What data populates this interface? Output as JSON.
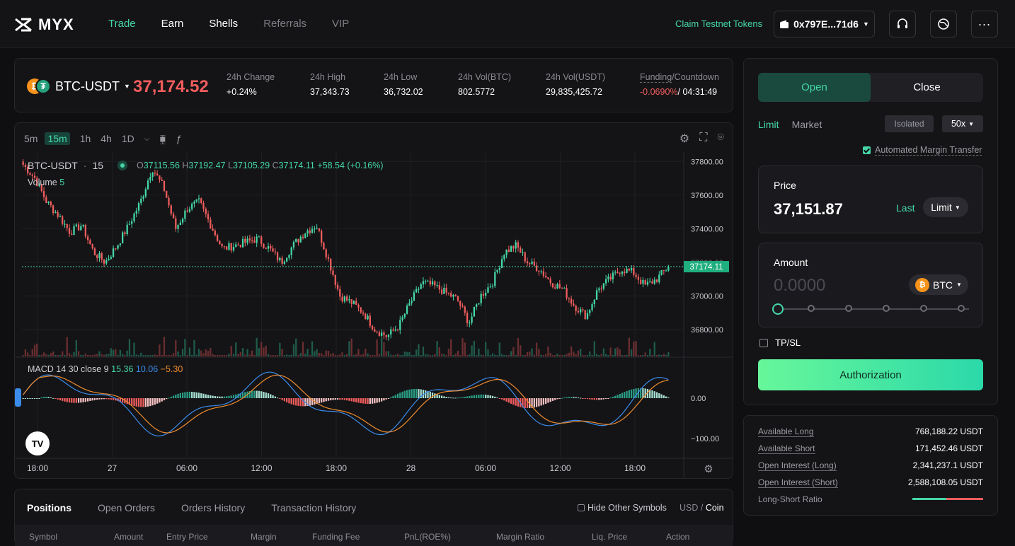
{
  "nav": {
    "logo": "MYX",
    "items": [
      "Trade",
      "Earn",
      "Shells",
      "Referrals",
      "VIP"
    ],
    "claim": "Claim Testnet Tokens",
    "wallet": "0x797E...71d6"
  },
  "ticker": {
    "pair": "BTC-USDT",
    "price": "37,174.52",
    "stats": [
      {
        "label": "24h Change",
        "value": "+0.24%"
      },
      {
        "label": "24h High",
        "value": "37,343.73"
      },
      {
        "label": "24h Low",
        "value": "36,732.02"
      },
      {
        "label": "24h Vol(BTC)",
        "value": "802.5772"
      },
      {
        "label": "24h Vol(USDT)",
        "value": "29,835,425.72"
      }
    ],
    "funding_label": "Funding",
    "countdown_label": "/Countdown",
    "funding_value": "-0.0690%",
    "countdown_value": "/ 04:31:49"
  },
  "chart": {
    "timeframes": [
      "5m",
      "15m",
      "1h",
      "4h",
      "1D"
    ],
    "active_timeframe": "15m",
    "symbol": "BTC-USDT",
    "interval": "15",
    "ohlc": {
      "o": "37115.56",
      "h": "37192.47",
      "l": "37105.29",
      "c": "37174.11",
      "chg": "+58.54 (+0.16%)"
    },
    "volume_label": "Volume",
    "volume_value": "5",
    "macd_label": "MACD 14 30 close 9",
    "macd_values": [
      "15.36",
      "10.06",
      "−5.30"
    ],
    "price_ticks": [
      "37800.00",
      "37600.00",
      "37400.00",
      "37200.00",
      "37000.00",
      "36800.00"
    ],
    "current_price_tag": "37174.11",
    "macd_ticks": [
      "0.00",
      "−100.00"
    ],
    "time_ticks": [
      "18:00",
      "27",
      "06:00",
      "12:00",
      "18:00",
      "28",
      "06:00",
      "12:00",
      "18:00"
    ],
    "tv_logo": "TV"
  },
  "chart_data": {
    "type": "candlestick",
    "xlabel": "",
    "ylabel": "",
    "ylim": [
      36640,
      37860
    ],
    "current_price": 37174.11,
    "close_path_approx": [
      37780,
      37700,
      37560,
      37480,
      37380,
      37420,
      37260,
      37200,
      37300,
      37420,
      37560,
      37760,
      37640,
      37400,
      37520,
      37560,
      37420,
      37280,
      37300,
      37320,
      37340,
      37280,
      37200,
      37300,
      37380,
      37420,
      37220,
      37000,
      36960,
      36900,
      36800,
      36760,
      36820,
      36960,
      37080,
      37060,
      37020,
      36980,
      36840,
      37000,
      37080,
      37260,
      37300,
      37200,
      37160,
      37080,
      37040,
      36940,
      36880,
      37040,
      37100,
      37160,
      37140,
      37060,
      37100,
      37174
    ]
  },
  "positions": {
    "tabs": [
      "Positions",
      "Open Orders",
      "Orders History",
      "Transaction History"
    ],
    "hide_other": "Hide Other Symbols",
    "usd": "USD",
    "coin": "Coin",
    "columns": [
      "Symbol",
      "Amount",
      "Entry Price",
      "Margin",
      "Funding Fee",
      "PnL(ROE%)",
      "Margin Ratio",
      "Liq. Price",
      "Action"
    ]
  },
  "order": {
    "open": "Open",
    "close": "Close",
    "limit": "Limit",
    "market": "Market",
    "isolated": "Isolated",
    "leverage": "50x",
    "auto_margin": "Automated Margin Transfer",
    "price_label": "Price",
    "price_value": "37,151.87",
    "last_label": "Last",
    "price_type": "Limit",
    "amount_label": "Amount",
    "amount_placeholder": "0.0000",
    "amount_unit": "BTC",
    "tpsl": "TP/SL",
    "submit": "Authorization"
  },
  "stats": {
    "rows": [
      {
        "label": "Available Long",
        "value": "768,188.22 USDT"
      },
      {
        "label": "Available Short",
        "value": "171,452.46 USDT"
      },
      {
        "label": "Open Interest (Long)",
        "value": "2,341,237.1 USDT"
      },
      {
        "label": "Open Interest (Short)",
        "value": "2,588,108.05 USDT"
      },
      {
        "label": "Long-Short Ratio",
        "value": ""
      }
    ],
    "long_share": 0.48
  },
  "colors": {
    "accent": "#45d7a6",
    "down": "#f05d5d",
    "macd": "#3b8beb",
    "signal": "#f08c2e"
  }
}
